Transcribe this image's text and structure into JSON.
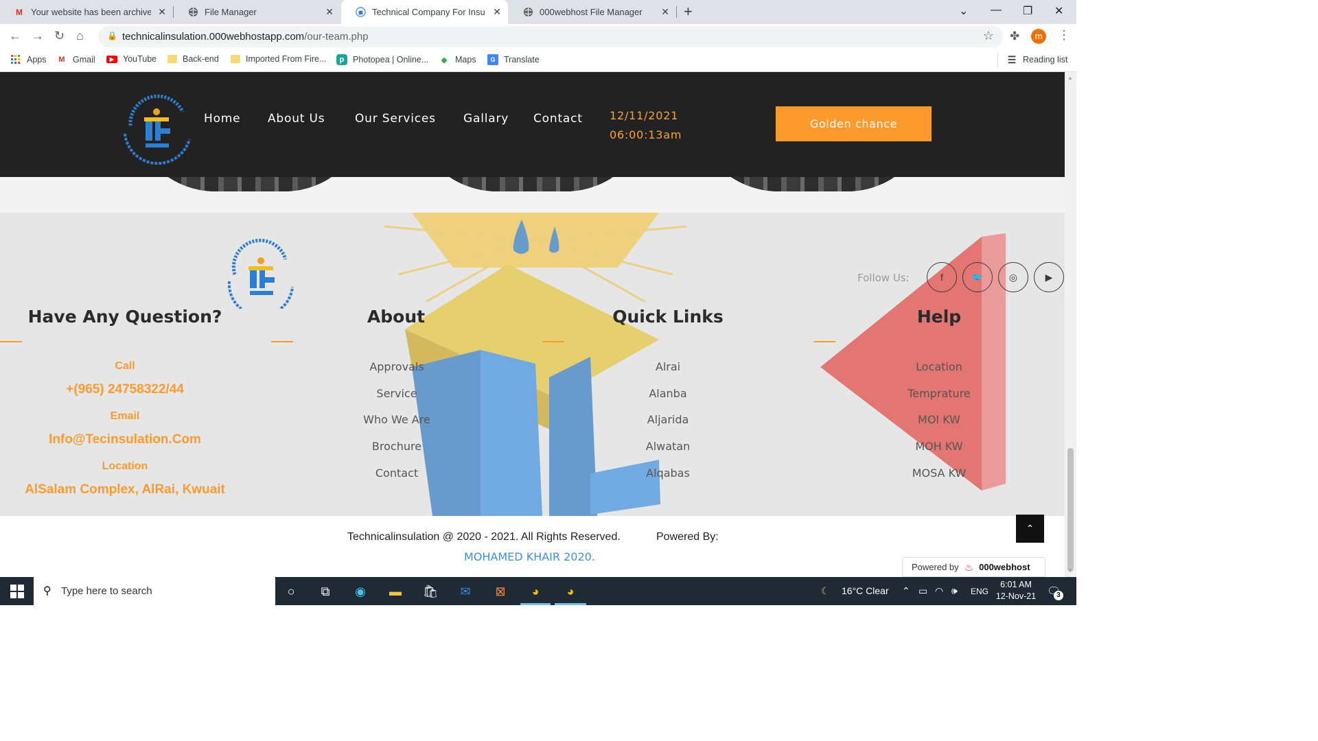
{
  "browser": {
    "tabs": [
      {
        "title": "Your website has been archived",
        "icon": "gmail-icon"
      },
      {
        "title": "File Manager",
        "icon": "globe-icon"
      },
      {
        "title": "Technical Company For Insulation",
        "icon": "site-logo-icon"
      },
      {
        "title": "000webhost File Manager",
        "icon": "globe-icon"
      }
    ],
    "url_host": "technicalinsulation.000webhostapp.com",
    "url_path": "/our-team.php",
    "profile_initial": "m",
    "bookmarks": [
      "Apps",
      "Gmail",
      "YouTube",
      "Back-end",
      "Imported From Fire...",
      "Photopea | Online...",
      "Maps",
      "Translate"
    ],
    "reading_list": "Reading list"
  },
  "header": {
    "nav": [
      "Home",
      "About Us",
      "Our Services",
      "Gallary",
      "Contact"
    ],
    "date": "12/11/2021",
    "time": "06:00:13am",
    "cta": "Golden chance"
  },
  "footer": {
    "follow_label": "Follow Us:",
    "social": [
      "facebook-icon",
      "twitter-icon",
      "instagram-icon",
      "youtube-icon"
    ],
    "contact": {
      "heading": "Have Any Question?",
      "call_label": "Call",
      "call_value": "+(965) 24758322/44",
      "email_label": "Email",
      "email_value": "Info@Tecinsulation.Com",
      "location_label": "Location",
      "location_value": "AlSalam Complex, AlRai, Kwuait"
    },
    "about": {
      "heading": "About",
      "links": [
        "Approvals",
        "Service",
        "Who We Are",
        "Brochure",
        "Contact"
      ]
    },
    "quick": {
      "heading": "Quick Links",
      "links": [
        "Alrai",
        "Alanba",
        "Aljarida",
        "Alwatan",
        "Alqabas"
      ]
    },
    "help": {
      "heading": "Help",
      "links": [
        "Location",
        "Temprature",
        "MOI KW",
        "MOH KW",
        "MOSA KW"
      ]
    },
    "copyright": "Technicalinsulation @ 2020 - 2021. All Rights Reserved.",
    "powered_by": "Powered By:",
    "author": "MOHAMED KHAIR 2020.",
    "badge_prefix": "Powered by",
    "badge_brand": "000webhost"
  },
  "taskbar": {
    "search_placeholder": "Type here to search",
    "weather": "16°C  Clear",
    "lang": "ENG",
    "time": "6:01 AM",
    "date": "12-Nov-21",
    "notifications": "3"
  },
  "colors": {
    "accent": "#fd9a2e",
    "header_bg": "#222222",
    "link_blue": "#3b8fe6"
  }
}
